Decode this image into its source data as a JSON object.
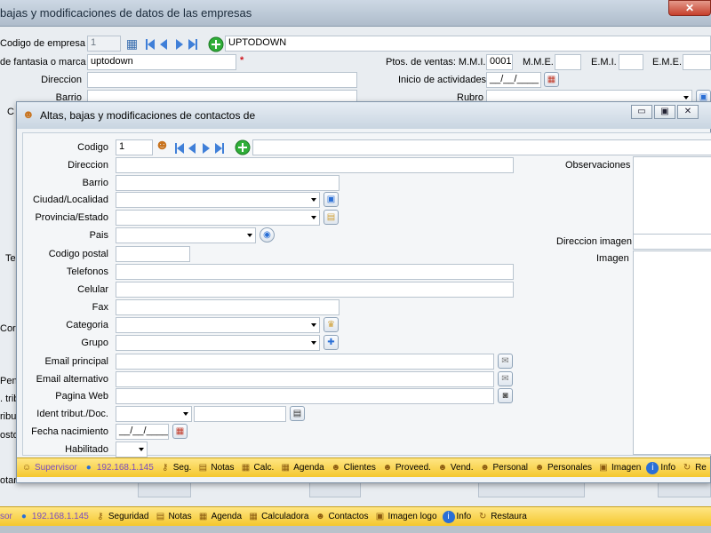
{
  "main": {
    "title": "bajas y modificaciones de datos de las empresas",
    "close_glyph": "✕",
    "labels": {
      "codigo": "Codigo  de empresa",
      "fantasia": "de fantasia o marca",
      "direccion": "Direccion",
      "barrio": "Barrio",
      "ptos": "Ptos. de ventas: M.M.I.",
      "mme": "M.M.E.",
      "emi": "E.M.I.",
      "eme": "E.M.E.",
      "inicio": "Inicio de actividades",
      "rubro": "Rubro"
    },
    "values": {
      "codigo": "1",
      "empresa": "UPTODOWN",
      "fantasia": "uptodown",
      "required_mark": "*",
      "ptos_mmi": "0001",
      "inicio": "__/__/____"
    },
    "behind_row": "Teléfono de código",
    "edge_fragments": [
      "C",
      "Tel",
      "Corr",
      "Pen",
      ". trib",
      "ributa",
      "osto",
      "otar"
    ]
  },
  "child": {
    "title": "Altas, bajas y modificaciones de contactos de",
    "labels": {
      "codigo": "Codigo",
      "direccion": "Direccion",
      "barrio": "Barrio",
      "ciudad": "Ciudad/Localidad",
      "provincia": "Provincia/Estado",
      "pais": "Pais",
      "cp": "Codigo postal",
      "telefonos": "Telefonos",
      "celular": "Celular",
      "fax": "Fax",
      "categoria": "Categoria",
      "grupo": "Grupo",
      "email1": "Email principal",
      "email2": "Email alternativo",
      "web": "Pagina Web",
      "ident": "Ident tribut./Doc.",
      "nacimiento": "Fecha nacimiento",
      "habilitado": "Habilitado",
      "observaciones": "Observaciones",
      "dir_imagen": "Direccion imagen",
      "imagen": "Imagen"
    },
    "values": {
      "codigo": "1",
      "nacimiento": "__/__/____"
    },
    "window_buttons": {
      "minimize": "▭",
      "restore": "▣",
      "close": "✕"
    }
  },
  "child_status": [
    {
      "icon": "supervisor-icon",
      "glyph": "☺",
      "label": "Supervisor",
      "color": "#7a4cc2"
    },
    {
      "icon": "network-icon",
      "glyph": "●",
      "label": "192.168.1.145",
      "color": "#7a4cc2"
    },
    {
      "icon": "key-icon",
      "glyph": "⚷",
      "label": "Seg.",
      "color": "#000000"
    },
    {
      "icon": "notes-icon",
      "glyph": "▤",
      "label": "Notas",
      "color": "#000000"
    },
    {
      "icon": "calculator-icon",
      "glyph": "▦",
      "label": "Calc.",
      "color": "#000000"
    },
    {
      "icon": "calendar-icon",
      "glyph": "▦",
      "label": "Agenda",
      "color": "#000000"
    },
    {
      "icon": "clients-icon",
      "glyph": "☻",
      "label": "Clientes",
      "color": "#000000"
    },
    {
      "icon": "suppliers-icon",
      "glyph": "☻",
      "label": "Proveed.",
      "color": "#000000"
    },
    {
      "icon": "sellers-icon",
      "glyph": "☻",
      "label": "Vend.",
      "color": "#000000"
    },
    {
      "icon": "staff-icon",
      "glyph": "☻",
      "label": "Personal",
      "color": "#000000"
    },
    {
      "icon": "personal-icon",
      "glyph": "☻",
      "label": "Personales",
      "color": "#000000"
    },
    {
      "icon": "image-icon",
      "glyph": "▣",
      "label": "Imagen",
      "color": "#000000"
    },
    {
      "icon": "info-icon",
      "glyph": "i",
      "label": "Info",
      "color": "#000000"
    },
    {
      "icon": "refresh-icon",
      "glyph": "↻",
      "label": "Re",
      "color": "#000000"
    }
  ],
  "main_status": [
    {
      "icon": "supervisor-icon",
      "glyph": "",
      "label": "sor",
      "color": "#7a4cc2"
    },
    {
      "icon": "network-icon",
      "glyph": "●",
      "label": "192.168.1.145",
      "color": "#7a4cc2"
    },
    {
      "icon": "key-icon",
      "glyph": "⚷",
      "label": "Seguridad",
      "color": "#000000"
    },
    {
      "icon": "notes-icon",
      "glyph": "▤",
      "label": "Notas",
      "color": "#000000"
    },
    {
      "icon": "calendar-icon",
      "glyph": "▦",
      "label": "Agenda",
      "color": "#000000"
    },
    {
      "icon": "calculator-icon",
      "glyph": "▦",
      "label": "Calculadora",
      "color": "#000000"
    },
    {
      "icon": "contacts-icon",
      "glyph": "☻",
      "label": "Contactos",
      "color": "#000000"
    },
    {
      "icon": "image-logo-icon",
      "glyph": "▣",
      "label": "Imagen logo",
      "color": "#000000"
    },
    {
      "icon": "info-icon",
      "glyph": "i",
      "label": "Info",
      "color": "#000000"
    },
    {
      "icon": "restore-icon",
      "glyph": "↻",
      "label": "Restaura",
      "color": "#000000"
    }
  ],
  "colors": {
    "accent": "#2a6fd6",
    "status_bg": "#f6cf3e",
    "nav": "#3f7fd8",
    "add": "#2fae38"
  }
}
